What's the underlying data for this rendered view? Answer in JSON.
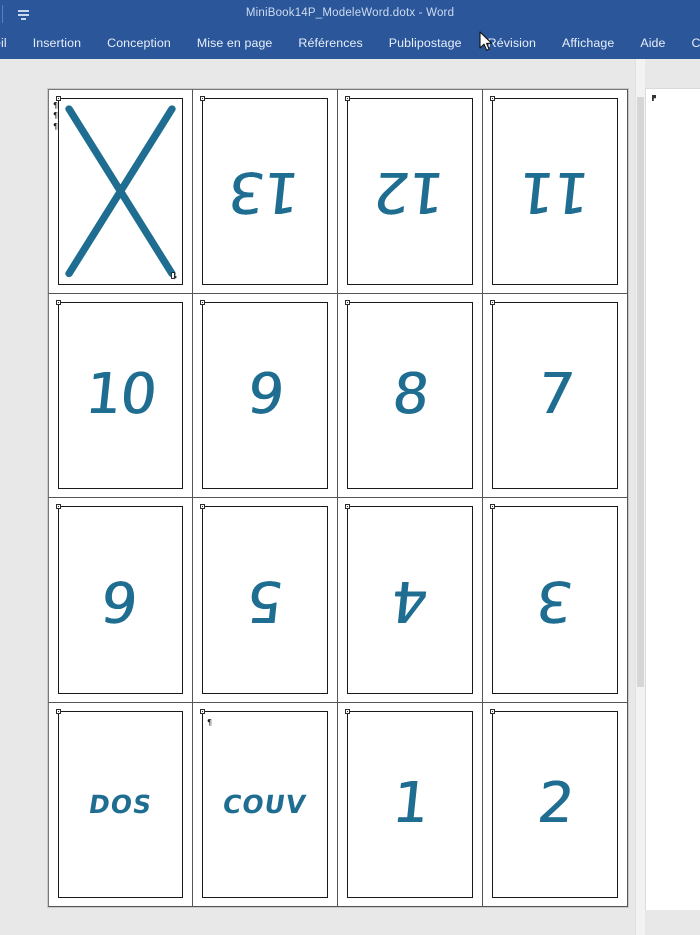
{
  "window": {
    "title": "MiniBook14P_ModeleWord.dotx  -  Word",
    "quick_access_icon": "save-overflow-icon"
  },
  "ribbon": {
    "tabs": [
      {
        "label": "eil",
        "name": "tab-accueil",
        "truncated": true
      },
      {
        "label": "Insertion",
        "name": "tab-insertion"
      },
      {
        "label": "Conception",
        "name": "tab-conception"
      },
      {
        "label": "Mise en page",
        "name": "tab-mise-en-page"
      },
      {
        "label": "Références",
        "name": "tab-references"
      },
      {
        "label": "Publipostage",
        "name": "tab-publipostage"
      },
      {
        "label": "Révision",
        "name": "tab-revision"
      },
      {
        "label": "Affichage",
        "name": "tab-affichage"
      },
      {
        "label": "Aide",
        "name": "tab-aide"
      },
      {
        "label": "Création",
        "name": "tab-creation",
        "truncated": true
      }
    ]
  },
  "document": {
    "ink_color": "#1f6e91",
    "page_background": "#ffffff",
    "canvas_background": "#e8e8e8",
    "columns": 4,
    "rows": 4,
    "pages": [
      {
        "index": 1,
        "content": "X",
        "kind": "cross",
        "rotated": false
      },
      {
        "index": 2,
        "content": "13",
        "kind": "number",
        "rotated": true
      },
      {
        "index": 3,
        "content": "12",
        "kind": "number",
        "rotated": true
      },
      {
        "index": 4,
        "content": "11",
        "kind": "number",
        "rotated": true
      },
      {
        "index": 5,
        "content": "10",
        "kind": "number",
        "rotated": false
      },
      {
        "index": 6,
        "content": "9",
        "kind": "number",
        "rotated": false
      },
      {
        "index": 7,
        "content": "8",
        "kind": "number",
        "rotated": false
      },
      {
        "index": 8,
        "content": "7",
        "kind": "number",
        "rotated": false
      },
      {
        "index": 9,
        "content": "6",
        "kind": "number",
        "rotated": true
      },
      {
        "index": 10,
        "content": "5",
        "kind": "number",
        "rotated": true
      },
      {
        "index": 11,
        "content": "4",
        "kind": "number",
        "rotated": true
      },
      {
        "index": 12,
        "content": "3",
        "kind": "number",
        "rotated": true
      },
      {
        "index": 13,
        "content": "DOS",
        "kind": "word",
        "rotated": false
      },
      {
        "index": 14,
        "content": "COUV",
        "kind": "word",
        "rotated": false
      },
      {
        "index": 15,
        "content": "1",
        "kind": "number",
        "rotated": false
      },
      {
        "index": 16,
        "content": "2",
        "kind": "number",
        "rotated": false
      }
    ]
  },
  "scrollbar": {
    "orientation": "vertical",
    "thumb_label": "vertical-scroll-thumb"
  }
}
